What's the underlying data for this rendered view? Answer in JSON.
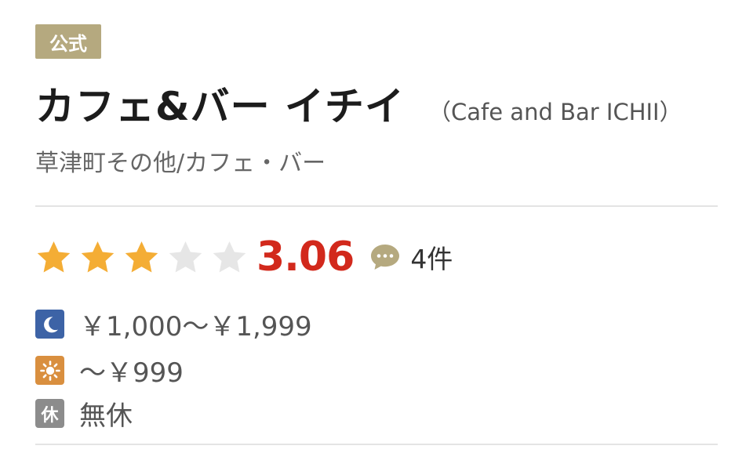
{
  "badge": {
    "label": "公式"
  },
  "restaurant": {
    "name": "カフェ&バー イチイ",
    "name_romaji": "（Cafe and Bar ICHII）",
    "area_genre": "草津町その他/カフェ・バー"
  },
  "rating": {
    "score": "3.06",
    "stars_filled": 3,
    "stars_total": 5,
    "review_count": "4件",
    "star_color": "#f4ad35",
    "score_color": "#d2291c"
  },
  "budget": {
    "dinner_icon": "moon-icon",
    "dinner": "￥1,000～￥1,999",
    "lunch_icon": "sun-icon",
    "lunch": "～￥999",
    "holiday_icon_label": "休",
    "holiday": "無休"
  }
}
